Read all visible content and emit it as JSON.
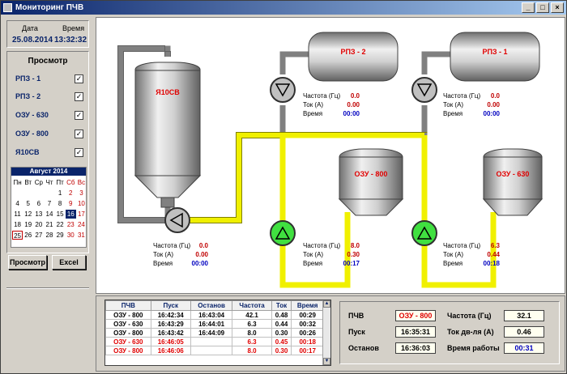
{
  "window": {
    "title": "Мониторинг ПЧВ"
  },
  "datetime": {
    "date_label": "Дата",
    "time_label": "Время",
    "date": "25.08.2014",
    "time": "13:32:32"
  },
  "view": {
    "title": "Просмотр",
    "items": [
      {
        "label": "РПЗ - 1",
        "checked": "✓"
      },
      {
        "label": "РПЗ - 2",
        "checked": "✓"
      },
      {
        "label": "ОЗУ - 630",
        "checked": "✓"
      },
      {
        "label": "ОЗУ - 800",
        "checked": "✓"
      },
      {
        "label": "Я10СВ",
        "checked": "✓"
      }
    ]
  },
  "calendar": {
    "month": "Август 2014",
    "weekdays": [
      "Пн",
      "Вт",
      "Ср",
      "Чт",
      "Пт",
      "Сб",
      "Вс"
    ],
    "cells": [
      "",
      "",
      "",
      "",
      "1",
      "2",
      "3",
      "4",
      "5",
      "6",
      "7",
      "8",
      "9",
      "10",
      "11",
      "12",
      "13",
      "14",
      "15",
      "16",
      "17",
      "18",
      "19",
      "20",
      "21",
      "22",
      "23",
      "24",
      "25",
      "26",
      "27",
      "28",
      "29",
      "30",
      "31"
    ]
  },
  "buttons": {
    "view": "Просмотр",
    "excel": "Excel"
  },
  "tanks": {
    "ya10sv": "Я10СВ",
    "rpz2": "РПЗ - 2",
    "rpz1": "РПЗ - 1",
    "ozu800": "ОЗУ - 800",
    "ozu630": "ОЗУ - 630"
  },
  "params": {
    "freq_label": "Частота (Гц)",
    "current_label": "Ток (А)",
    "time_label": "Время",
    "ya10sv": {
      "freq": "0.0",
      "current": "0.00",
      "time": "00:00"
    },
    "rpz2": {
      "freq": "0.0",
      "current": "0.00",
      "time": "00:00"
    },
    "rpz1": {
      "freq": "0.0",
      "current": "0.00",
      "time": "00:00"
    },
    "ozu800": {
      "freq": "8.0",
      "current": "0.30",
      "time": "00:17"
    },
    "ozu630": {
      "freq": "6.3",
      "current": "0.44",
      "time": "00:18"
    }
  },
  "table": {
    "headers": [
      "ПЧВ",
      "Пуск",
      "Останов",
      "Частота",
      "Ток",
      "Время"
    ],
    "rows": [
      [
        "ОЗУ - 800",
        "16:42:34",
        "16:43:04",
        "42.1",
        "0.48",
        "00:29"
      ],
      [
        "ОЗУ - 630",
        "16:43:29",
        "16:44:01",
        "6.3",
        "0.44",
        "00:32"
      ],
      [
        "ОЗУ - 800",
        "16:43:42",
        "16:44:09",
        "8.0",
        "0.30",
        "00:26"
      ],
      [
        "ОЗУ - 630",
        "16:46:05",
        "",
        "6.3",
        "0.45",
        "00:18"
      ],
      [
        "ОЗУ - 800",
        "16:46:06",
        "",
        "8.0",
        "0.30",
        "00:17"
      ]
    ]
  },
  "status": {
    "pchv_label": "ПЧВ",
    "pchv_value": "ОЗУ - 800",
    "start_label": "Пуск",
    "start_value": "16:35:31",
    "stop_label": "Останов",
    "stop_value": "16:36:03",
    "freq_label": "Частота (Гц)",
    "freq_value": "32.1",
    "current_label": "Ток дв-ля (А)",
    "current_value": "0.46",
    "runtime_label": "Время работы",
    "runtime_value": "00:31"
  },
  "colors": {
    "title_bar": "#0a246a",
    "pipe_active": "#f0f000",
    "pipe_idle": "#a0a0a0",
    "pump_on": "#40e040",
    "pump_off": "#c0c0c0",
    "alert": "#e00000"
  },
  "icons": {
    "pump_running": "triangle-up-icon",
    "pump_stopped": "triangle-down-icon"
  }
}
